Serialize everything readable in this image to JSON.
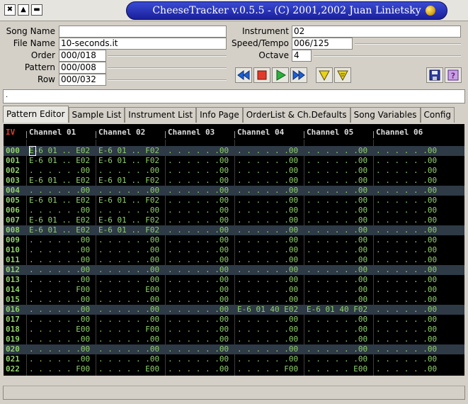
{
  "window": {
    "title": "CheeseTracker v.0.5.5 - (C) 2001,2002 Juan Linietsky",
    "controls": [
      "close-icon",
      "maximize-icon",
      "minimize-icon"
    ]
  },
  "form": {
    "song_name": {
      "label": "Song Name",
      "value": ""
    },
    "file_name": {
      "label": "File Name",
      "value": "10-seconds.it"
    },
    "order": {
      "label": "Order",
      "value": "000/018"
    },
    "pattern": {
      "label": "Pattern",
      "value": "000/008"
    },
    "row": {
      "label": "Row",
      "value": "000/032"
    },
    "instrument": {
      "label": "Instrument",
      "value": "02"
    },
    "speed_tempo": {
      "label": "Speed/Tempo",
      "value": "006/125"
    },
    "octave": {
      "label": "Octave",
      "value": "4"
    }
  },
  "transport": [
    "rewind-icon",
    "stop-icon",
    "play-icon",
    "fast-forward-icon",
    "play-pattern-icon",
    "play-from-cursor-icon",
    "save-icon",
    "help-icon"
  ],
  "info_strip": ".",
  "tabs": [
    {
      "label": "Pattern Editor",
      "active": true
    },
    {
      "label": "Sample List",
      "active": false
    },
    {
      "label": "Instrument List",
      "active": false
    },
    {
      "label": "Info Page",
      "active": false
    },
    {
      "label": "OrderList & Ch.Defaults",
      "active": false
    },
    {
      "label": "Song Variables",
      "active": false
    },
    {
      "label": "Config",
      "active": false
    }
  ],
  "pattern_editor": {
    "corner_label": "IV",
    "channels": [
      "Channel 01",
      "Channel 02",
      "Channel 03",
      "Channel 04",
      "Channel 05",
      "Channel 06"
    ],
    "highlight_rows": [
      0,
      4,
      8,
      12,
      16,
      20
    ],
    "rows": [
      {
        "num": "000",
        "cells": [
          "E-6 01 .. E02",
          "E-6 01 .. F02",
          ". . . . . .00",
          ". . . . . .00",
          ". . . . . .00",
          ". . . . . .00"
        ]
      },
      {
        "num": "001",
        "cells": [
          "E-6 01 .. E02",
          "E-6 01 .. F02",
          ". . . . . .00",
          ". . . . . .00",
          ". . . . . .00",
          ". . . . . .00"
        ]
      },
      {
        "num": "002",
        "cells": [
          ". . . . . .00",
          ". . . . . .00",
          ". . . . . .00",
          ". . . . . .00",
          ". . . . . .00",
          ". . . . . .00"
        ]
      },
      {
        "num": "003",
        "cells": [
          "E-6 01 .. E02",
          "E-6 01 .. F02",
          ". . . . . .00",
          ". . . . . .00",
          ". . . . . .00",
          ". . . . . .00"
        ]
      },
      {
        "num": "004",
        "cells": [
          ". . . . . .00",
          ". . . . . .00",
          ". . . . . .00",
          ". . . . . .00",
          ". . . . . .00",
          ". . . . . .00"
        ]
      },
      {
        "num": "005",
        "cells": [
          "E-6 01 .. E02",
          "E-6 01 .. F02",
          ". . . . . .00",
          ". . . . . .00",
          ". . . . . .00",
          ". . . . . .00"
        ]
      },
      {
        "num": "006",
        "cells": [
          ". . . . . .00",
          ". . . . . .00",
          ". . . . . .00",
          ". . . . . .00",
          ". . . . . .00",
          ". . . . . .00"
        ]
      },
      {
        "num": "007",
        "cells": [
          "E-6 01 .. E02",
          "E-6 01 .. F02",
          ". . . . . .00",
          ". . . . . .00",
          ". . . . . .00",
          ". . . . . .00"
        ]
      },
      {
        "num": "008",
        "cells": [
          "E-6 01 .. E02",
          "E-6 01 .. F02",
          ". . . . . .00",
          ". . . . . .00",
          ". . . . . .00",
          ". . . . . .00"
        ]
      },
      {
        "num": "009",
        "cells": [
          ". . . . . .00",
          ". . . . . .00",
          ". . . . . .00",
          ". . . . . .00",
          ". . . . . .00",
          ". . . . . .00"
        ]
      },
      {
        "num": "010",
        "cells": [
          ". . . . . .00",
          ". . . . . .00",
          ". . . . . .00",
          ". . . . . .00",
          ". . . . . .00",
          ". . . . . .00"
        ]
      },
      {
        "num": "011",
        "cells": [
          ". . . . . .00",
          ". . . . . .00",
          ". . . . . .00",
          ". . . . . .00",
          ". . . . . .00",
          ". . . . . .00"
        ]
      },
      {
        "num": "012",
        "cells": [
          ". . . . . .00",
          ". . . . . .00",
          ". . . . . .00",
          ". . . . . .00",
          ". . . . . .00",
          ". . . . . .00"
        ]
      },
      {
        "num": "013",
        "cells": [
          ". . . . . .00",
          ". . . . . .00",
          ". . . . . .00",
          ". . . . . .00",
          ". . . . . .00",
          ". . . . . .00"
        ]
      },
      {
        "num": "014",
        "cells": [
          ". . . . . F00",
          ". . . . . E00",
          ". . . . . .00",
          ". . . . . .00",
          ". . . . . .00",
          ". . . . . .00"
        ]
      },
      {
        "num": "015",
        "cells": [
          ". . . . . .00",
          ". . . . . .00",
          ". . . . . .00",
          ". . . . . .00",
          ". . . . . .00",
          ". . . . . .00"
        ]
      },
      {
        "num": "016",
        "cells": [
          ". . . . . .00",
          ". . . . . .00",
          ". . . . . .00",
          "E-6 01 40 E02",
          "E-6 01 40 F02",
          ". . . . . .00"
        ]
      },
      {
        "num": "017",
        "cells": [
          ". . . . . .00",
          ". . . . . .00",
          ". . . . . .00",
          ". . . . . .00",
          ". . . . . .00",
          ". . . . . .00"
        ]
      },
      {
        "num": "018",
        "cells": [
          ". . . . . E00",
          ". . . . . F00",
          ". . . . . .00",
          ". . . . . .00",
          ". . . . . .00",
          ". . . . . .00"
        ]
      },
      {
        "num": "019",
        "cells": [
          ". . . . . .00",
          ". . . . . .00",
          ". . . . . .00",
          ". . . . . .00",
          ". . . . . .00",
          ". . . . . .00"
        ]
      },
      {
        "num": "020",
        "cells": [
          ". . . . . .00",
          ". . . . . .00",
          ". . . . . .00",
          ". . . . . .00",
          ". . . . . .00",
          ". . . . . .00"
        ]
      },
      {
        "num": "021",
        "cells": [
          ". . . . . .00",
          ". . . . . .00",
          ". . . . . .00",
          ". . . . . .00",
          ". . . . . .00",
          ". . . . . .00"
        ]
      },
      {
        "num": "022",
        "cells": [
          ". . . . . F00",
          ". . . . . E00",
          ". . . . . .00",
          ". . . . . F00",
          ". . . . . E00",
          ". . . . . .00"
        ]
      }
    ]
  },
  "status_text": ""
}
